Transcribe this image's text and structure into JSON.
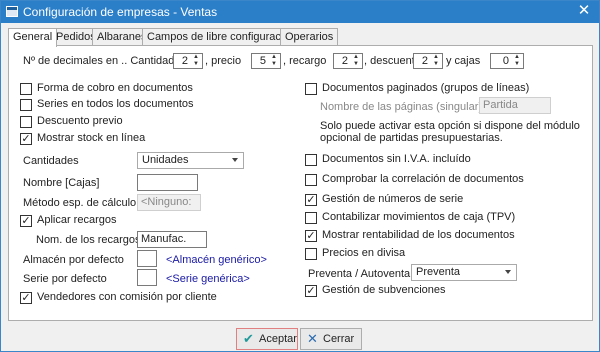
{
  "window": {
    "title": "Configuración de empresas - Ventas",
    "close": "✕"
  },
  "tabs": [
    "General",
    "Pedidos",
    "Albaranes",
    "Campos de libre configuración",
    "Operarios"
  ],
  "decimals": {
    "label": "Nº de decimales en .. Cantidad",
    "cantidad": "2",
    "precio_label": ", precio",
    "precio": "5",
    "recargo_label": ", recargo",
    "recargo": "2",
    "descuento_label": ", descuento",
    "descuento": "2",
    "cajas_label": "y cajas",
    "cajas": "0"
  },
  "left_checks": [
    {
      "label": "Forma de cobro en documentos",
      "checked": false
    },
    {
      "label": "Series en todos los documentos",
      "checked": false
    },
    {
      "label": "Descuento previo",
      "checked": false
    },
    {
      "label": "Mostrar stock en línea",
      "checked": true
    }
  ],
  "cantidades": {
    "label": "Cantidades",
    "value": "Unidades"
  },
  "nombre_cajas": {
    "label": "Nombre [Cajas]",
    "value": ""
  },
  "metodo": {
    "label": "Método esp. de cálculo",
    "value": "<Ninguno:"
  },
  "aplicar_recargos": {
    "label": "Aplicar recargos",
    "checked": true
  },
  "nom_recargos": {
    "label": "Nom. de los recargos",
    "value": "Manufac."
  },
  "almacen": {
    "label": "Almacén por defecto",
    "value": "",
    "link": "<Almacén genérico>"
  },
  "serie": {
    "label": "Serie por defecto",
    "value": "",
    "link": "<Serie genérica>"
  },
  "vendedores": {
    "label": "Vendedores con comisión por cliente",
    "checked": true
  },
  "right": {
    "paginados": {
      "label": "Documentos paginados (grupos de líneas)",
      "checked": false
    },
    "nombre_paginas": {
      "label": "Nombre de las páginas (singular)",
      "value": "Partida"
    },
    "note_line1": "Solo puede activar esta opción si dispone del módulo",
    "note_line2": "opcional de partidas presupuestarias.",
    "checks": [
      {
        "label": "Documentos sin I.V.A. incluído",
        "checked": false
      },
      {
        "label": "Comprobar la correlación de documentos",
        "checked": false
      },
      {
        "label": "Gestión de números de serie",
        "checked": true
      },
      {
        "label": "Contabilizar movimientos de caja (TPV)",
        "checked": false
      },
      {
        "label": "Mostrar rentabilidad de los documentos",
        "checked": true
      },
      {
        "label": "Precios en divisa",
        "checked": false
      }
    ],
    "preventa": {
      "label": "Preventa / Autoventa",
      "value": "Preventa"
    },
    "subvenciones": {
      "label": "Gestión de subvenciones",
      "checked": true
    }
  },
  "buttons": {
    "accept": "Aceptar",
    "cancel": "Cerrar"
  }
}
